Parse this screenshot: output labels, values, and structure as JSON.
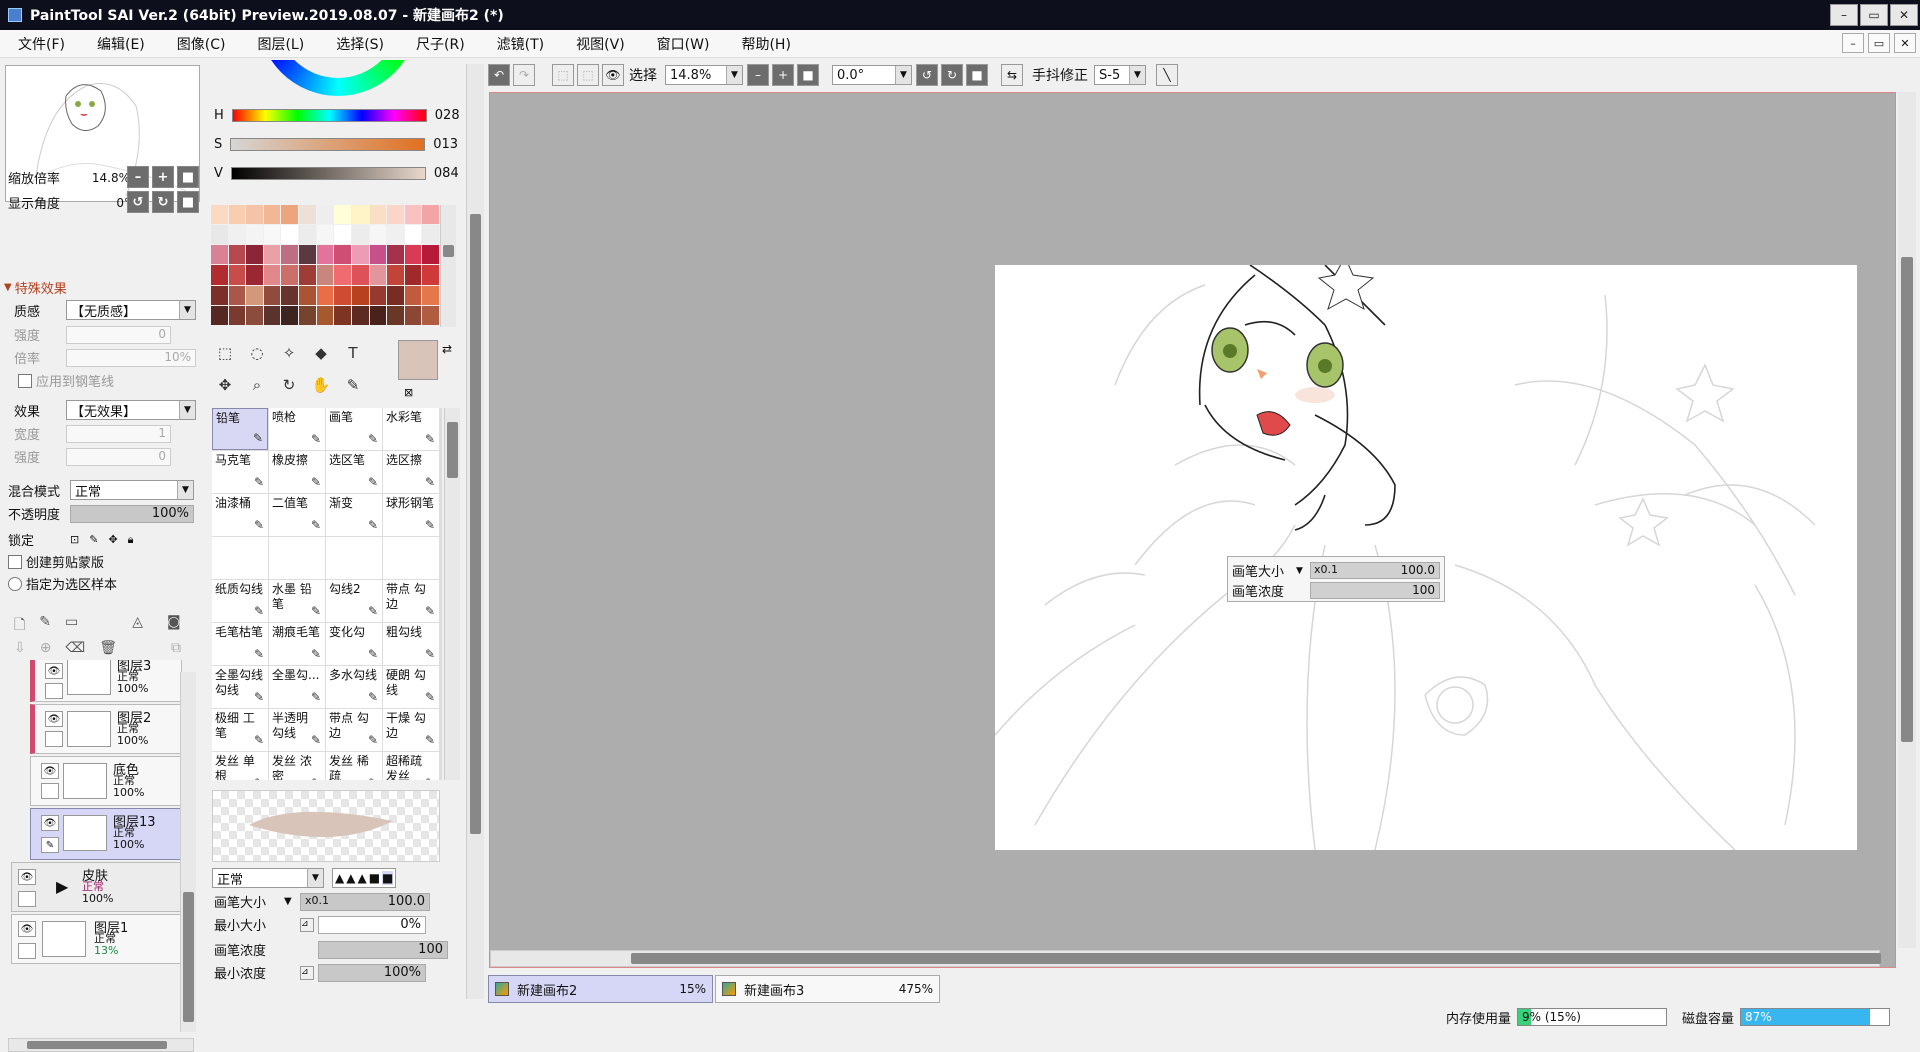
{
  "app": {
    "title": "PaintTool SAI Ver.2 (64bit) Preview.2019.08.07 - 新建画布2 (*)",
    "window_buttons": [
      "–",
      "▭",
      "✕"
    ],
    "mdi_buttons": [
      "–",
      "▭",
      "✕"
    ]
  },
  "menu": [
    "文件(F)",
    "编辑(E)",
    "图像(C)",
    "图层(L)",
    "选择(S)",
    "尺子(R)",
    "滤镜(T)",
    "视图(V)",
    "窗口(W)",
    "帮助(H)"
  ],
  "navigator": {
    "zoom_label": "缩放倍率",
    "zoom_value": "14.8%",
    "angle_label": "显示角度",
    "angle_value": "0°"
  },
  "effects": {
    "section_title": "特殊效果",
    "texture_label": "质感",
    "texture_value": "【无质感】",
    "strength_label": "强度",
    "strength_value": "0",
    "scale_label": "倍率",
    "scale_value": "10%",
    "apply_pen_label": "应用到钢笔线",
    "effect_label": "效果",
    "effect_value": "【无效果】",
    "width_label": "宽度",
    "width_value": "1",
    "strength2_label": "强度",
    "strength2_value": "0"
  },
  "layer_props": {
    "blend_label": "混合模式",
    "blend_value": "正常",
    "opacity_label": "不透明度",
    "opacity_value": "100%",
    "lock_label": "锁定",
    "clip_label": "创建剪贴蒙版",
    "selection_source_label": "指定为选区样本"
  },
  "layers": [
    {
      "name": "图层3",
      "mode": "正常",
      "opacity": "100%"
    },
    {
      "name": "图层2",
      "mode": "正常",
      "opacity": "100%"
    },
    {
      "name": "底色",
      "mode": "正常",
      "opacity": "100%"
    },
    {
      "name": "图层13",
      "mode": "正常",
      "opacity": "100%"
    },
    {
      "name": "皮肤",
      "mode": "正常",
      "opacity": "100%"
    },
    {
      "name": "图层1",
      "mode": "正常",
      "opacity": "13%"
    }
  ],
  "color": {
    "h_label": "H",
    "h_value": "028",
    "s_label": "S",
    "s_value": "013",
    "v_label": "V",
    "v_value": "084",
    "current": "#d8c4b8",
    "swatches": [
      "#fcd9c2",
      "#f8cdb0",
      "#f5c4a8",
      "#f2b896",
      "#eda57e",
      "#ece0d8",
      "#eeeeee",
      "#fffed8",
      "#fff4c8",
      "#f9dfc4",
      "#fbd6c8",
      "#f8c2c0",
      "#f2a4a6",
      "#e8e8e8",
      "#f0f0f0",
      "#f4f4f4",
      "#f8f8f8",
      "#ffffff",
      "#ececec",
      "#f6f6f6",
      "#ffffff",
      "#ececec",
      "#f6f6f6",
      "#f0f0f0",
      "#ffffff",
      "#ececec",
      "#d98296",
      "#b8484f",
      "#8c2537",
      "#e9a0a7",
      "#be6e83",
      "#5a3a40",
      "#e2739a",
      "#ce4e74",
      "#ec9cb4",
      "#c7508a",
      "#a4324c",
      "#da3a54",
      "#b61a38",
      "#b22c2f",
      "#c84c4a",
      "#9a2732",
      "#e1898a",
      "#cc6f6a",
      "#9e3d38",
      "#c9867d",
      "#f06b70",
      "#de5159",
      "#e2959a",
      "#c24438",
      "#a02a2a",
      "#ce3a3a",
      "#7c2f29",
      "#a85748",
      "#d1987c",
      "#904a3e",
      "#68332c",
      "#aa5434",
      "#e96e47",
      "#cf4c33",
      "#b8411f",
      "#963a2f",
      "#7a2c24",
      "#c25a3c",
      "#e4784a",
      "#552822",
      "#7b3a30",
      "#8a4c3c",
      "#5a342c",
      "#3e2420",
      "#75432e",
      "#a6582e",
      "#7e3422",
      "#5c2a22",
      "#4a221c",
      "#6a3626",
      "#8c4634",
      "#b05c40"
    ]
  },
  "tools": [
    "⬚",
    "◌",
    "✧",
    "◆",
    "T",
    "✥",
    "⌕",
    "↻",
    "✋",
    "✎"
  ],
  "brushes": [
    {
      "name": "铅笔",
      "sel": true
    },
    {
      "name": "喷枪"
    },
    {
      "name": "画笔"
    },
    {
      "name": "水彩笔"
    },
    {
      "name": "马克笔"
    },
    {
      "name": "橡皮擦"
    },
    {
      "name": "选区笔"
    },
    {
      "name": "选区擦"
    },
    {
      "name": "油漆桶"
    },
    {
      "name": "二值笔"
    },
    {
      "name": "渐变"
    },
    {
      "name": "球形钢笔"
    },
    {
      "name": ""
    },
    {
      "name": ""
    },
    {
      "name": ""
    },
    {
      "name": ""
    },
    {
      "name": "纸质勾线"
    },
    {
      "name": "水墨 铅笔"
    },
    {
      "name": "勾线2"
    },
    {
      "name": "带点 勾边"
    },
    {
      "name": "毛笔枯笔"
    },
    {
      "name": "潮痕毛笔"
    },
    {
      "name": "变化勾"
    },
    {
      "name": "粗勾线"
    },
    {
      "name": "全墨勾线 勾线"
    },
    {
      "name": "全墨勾..."
    },
    {
      "name": "多水勾线"
    },
    {
      "name": "硬朗 勾线"
    },
    {
      "name": "极细 工笔"
    },
    {
      "name": "半透明 勾线"
    },
    {
      "name": "带点 勾边"
    },
    {
      "name": "干燥 勾边"
    },
    {
      "name": "发丝 单根"
    },
    {
      "name": "发丝 浓密"
    },
    {
      "name": "发丝 稀疏"
    },
    {
      "name": "超稀疏 发丝"
    }
  ],
  "brush_settings": {
    "blend_value": "正常",
    "size_label": "画笔大小",
    "size_mult": "x0.1",
    "size_value": "100.0",
    "min_size_label": "最小大小",
    "min_size_value": "0%",
    "density_label": "画笔浓度",
    "density_value": "100",
    "min_density_label": "最小浓度",
    "min_density_value": "100%"
  },
  "toolbar": {
    "select_label": "选择",
    "zoom_value": "14.8%",
    "angle_value": "0.0°",
    "stabilizer_label": "手抖修正",
    "stabilizer_value": "S-5"
  },
  "popup": {
    "size_label": "画笔大小",
    "size_mult": "x0.1",
    "size_value": "100.0",
    "density_label": "画笔浓度",
    "density_value": "100"
  },
  "tabs": [
    {
      "name": "新建画布2",
      "zoom": "15%",
      "active": true
    },
    {
      "name": "新建画布3",
      "zoom": "475%",
      "active": false
    }
  ],
  "status": {
    "mem_label": "内存使用量",
    "mem_value": "9% (15%)",
    "mem_fraction": 0.09,
    "disk_label": "磁盘容量",
    "disk_value": "87%",
    "disk_fraction": 0.87
  }
}
